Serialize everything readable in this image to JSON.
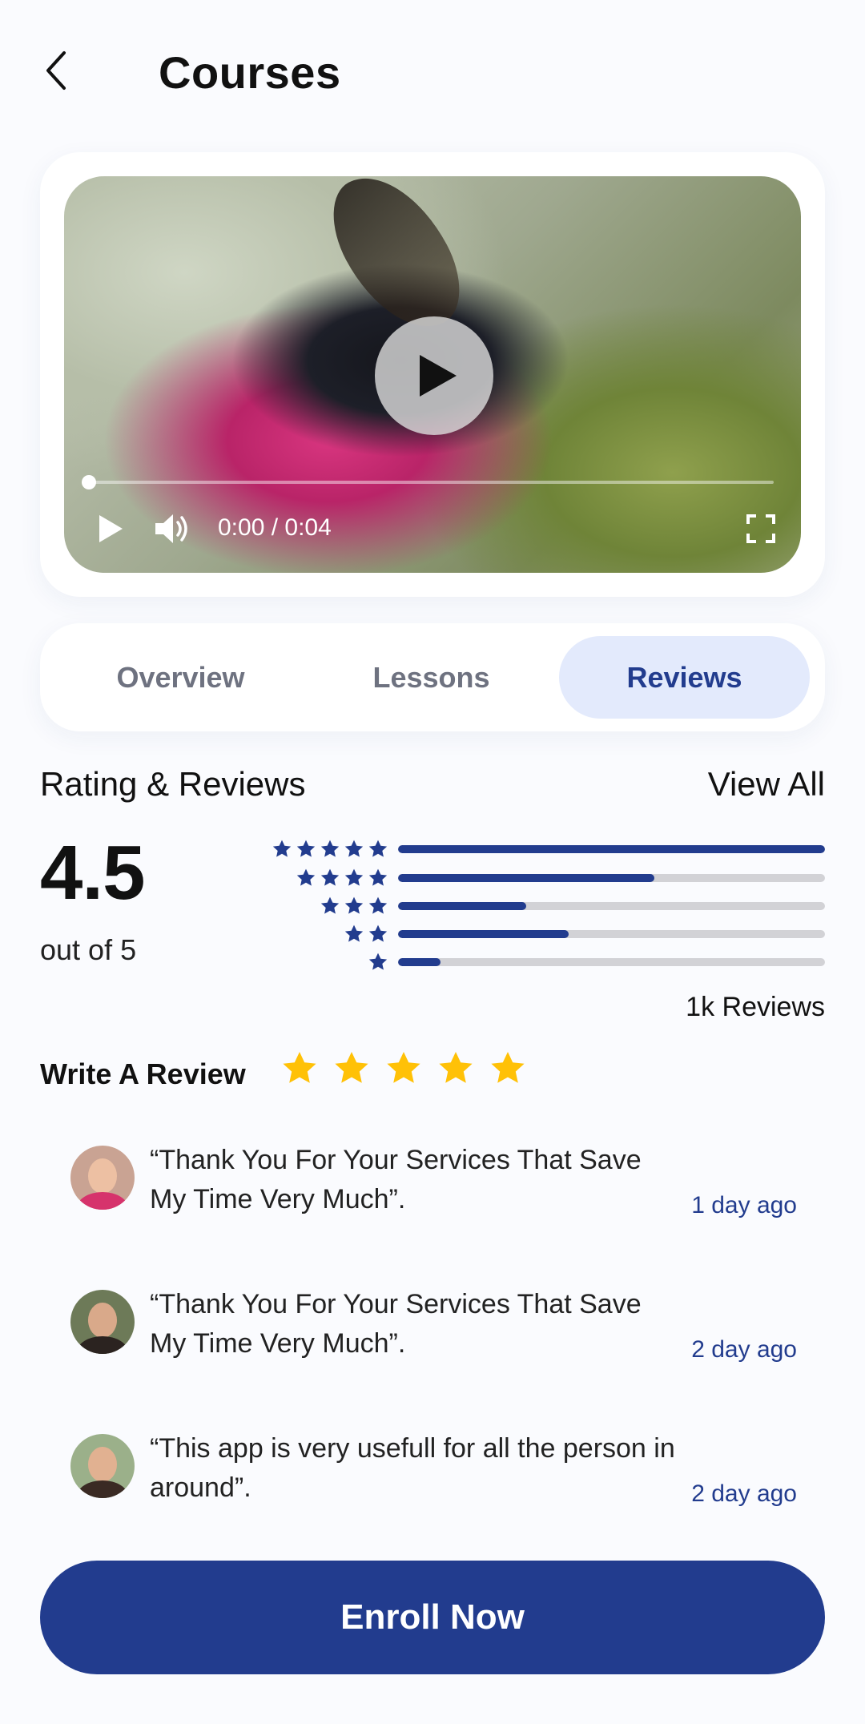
{
  "header": {
    "title": "Courses",
    "back_icon": "chevron-left-icon"
  },
  "video": {
    "time_label": "0:00 / 0:04",
    "progress": 0,
    "icons": [
      "play-icon",
      "volume-icon",
      "fullscreen-icon"
    ]
  },
  "tabs": [
    {
      "label": "Overview",
      "active": false
    },
    {
      "label": "Lessons",
      "active": false
    },
    {
      "label": "Reviews",
      "active": true
    }
  ],
  "rating": {
    "section_title": "Rating & Reviews",
    "view_all_label": "View All",
    "value": "4.5",
    "subtitle": "out of 5",
    "review_count": "1k Reviews",
    "distribution": [
      {
        "stars": 5,
        "fraction": 1.0
      },
      {
        "stars": 4,
        "fraction": 0.6
      },
      {
        "stars": 3,
        "fraction": 0.3
      },
      {
        "stars": 2,
        "fraction": 0.4
      },
      {
        "stars": 1,
        "fraction": 0.1
      }
    ]
  },
  "write_review": {
    "label": "Write A Review",
    "star_count": 5,
    "star_color": "#FFC107"
  },
  "reviews": [
    {
      "text": "“Thank You For Your Services That Save My Time Very Much”.",
      "date": "1 day ago"
    },
    {
      "text": "“Thank You For Your Services That Save My Time Very Much”.",
      "date": "2 day ago"
    },
    {
      "text": "“This app is very usefull for all the person in around”.",
      "date": "2 day ago"
    }
  ],
  "cta": {
    "label": "Enroll Now"
  },
  "colors": {
    "primary": "#223C8E",
    "tab_active_bg": "#E3EAFC",
    "star": "#FFC107",
    "bar_track": "#D2D2D6"
  }
}
